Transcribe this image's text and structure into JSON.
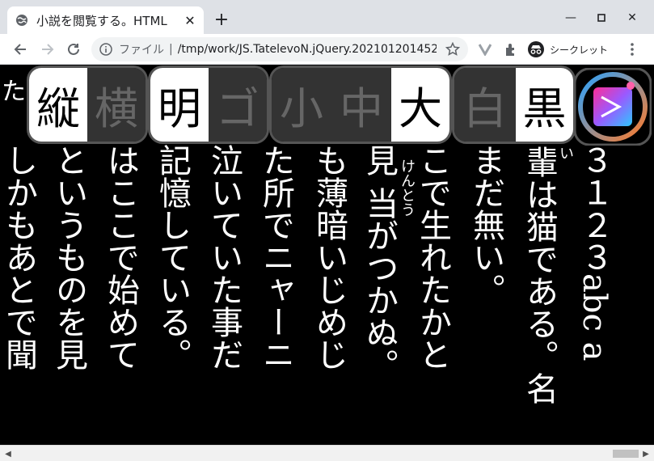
{
  "browser": {
    "tab_title": "小説を閲覧する。HTML",
    "new_tab_label": "+",
    "address_scheme": "ファイル",
    "address_url": "/tmp/work/JS.TatelevoN.jQuery.2021012014524...",
    "incognito_label": "シークレット"
  },
  "controls": {
    "orientation": [
      {
        "label": "縦",
        "state": "on"
      },
      {
        "label": "横",
        "state": "off"
      }
    ],
    "font": [
      {
        "label": "明",
        "state": "on"
      },
      {
        "label": "ゴ",
        "state": "off"
      }
    ],
    "size": [
      {
        "label": "小",
        "state": "off"
      },
      {
        "label": "中",
        "state": "off"
      },
      {
        "label": "大",
        "state": "on"
      }
    ],
    "theme": [
      {
        "label": "白",
        "state": "off"
      },
      {
        "label": "黒",
        "state": "on"
      }
    ]
  },
  "text": {
    "top_fragment": "た。",
    "columns": [
      "３１２３abc a",
      "輩は猫である。名",
      "まだ無い。",
      "こで生れたかと",
      "見 当がつかぬ。",
      "も薄暗いじめじ",
      "た所でニャーニ",
      "泣いていた事だ",
      "記憶している。",
      "はここで始めて",
      "というものを見",
      "しかもあとで聞"
    ],
    "ruby_i": "い",
    "ruby_kentou": "けんとう"
  },
  "colors": {
    "background": "#000000",
    "text": "#ffffff",
    "button_on": "#ffffff",
    "button_off_text": "#555555"
  }
}
